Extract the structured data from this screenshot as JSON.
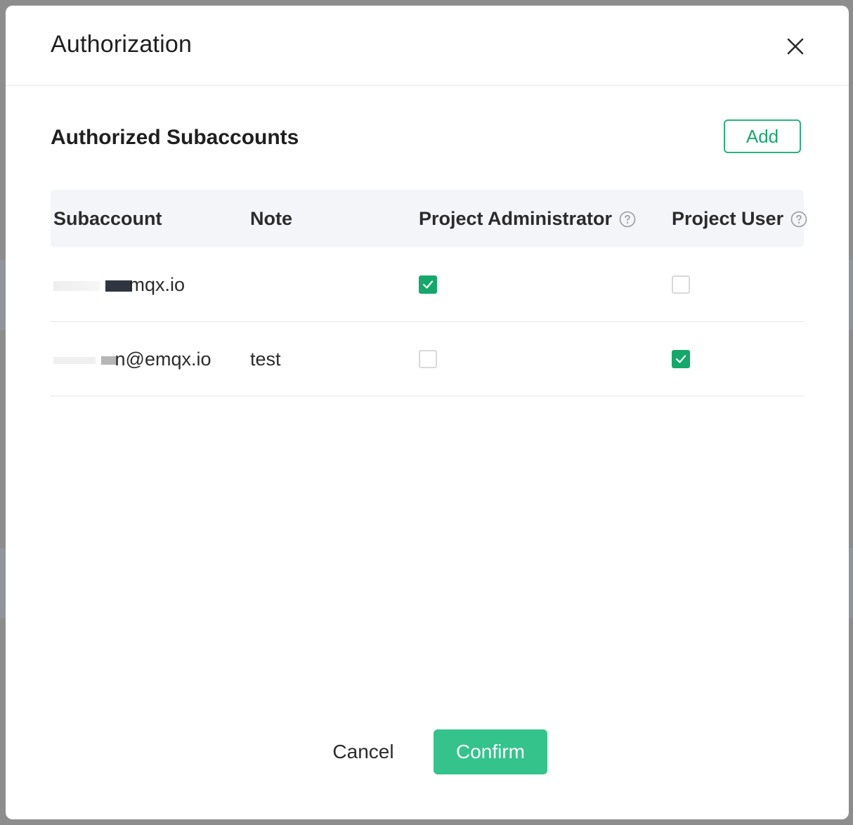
{
  "dialog": {
    "title": "Authorization",
    "close_icon": "close-icon"
  },
  "section": {
    "title": "Authorized Subaccounts",
    "add_label": "Add"
  },
  "table": {
    "columns": [
      "Subaccount",
      "Note",
      "Project Administrator",
      "Project User"
    ],
    "help_icon": "question-circle-icon",
    "rows": [
      {
        "subaccount_suffix": "mqx.io",
        "note": "",
        "project_administrator": true,
        "project_user": false
      },
      {
        "subaccount_suffix": "n@emqx.io",
        "note": "test",
        "project_administrator": false,
        "project_user": true
      }
    ]
  },
  "footer": {
    "cancel_label": "Cancel",
    "confirm_label": "Confirm"
  },
  "colors": {
    "accent": "#34c48b",
    "checkbox_checked": "#14a86a",
    "header_bg": "#f4f5f9"
  }
}
